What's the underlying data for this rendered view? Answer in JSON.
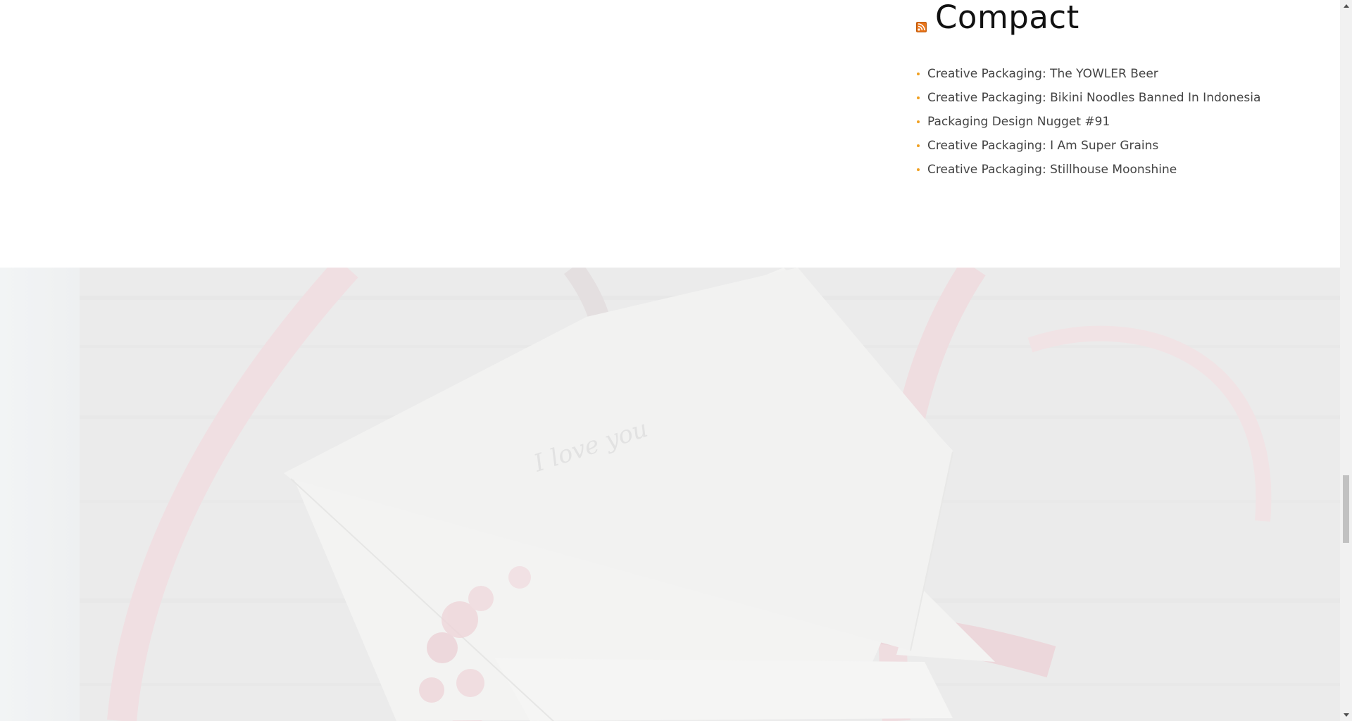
{
  "widget": {
    "title": "Compact",
    "icon": "rss-icon",
    "bullet_color": "#f0a020",
    "posts": [
      {
        "label": "Creative Packaging: The YOWLER Beer"
      },
      {
        "label": "Creative Packaging: Bikini Noodles Banned In Indonesia"
      },
      {
        "label": "Packaging Design Nugget #91"
      },
      {
        "label": "Creative Packaging: I Am Super Grains"
      },
      {
        "label": "Creative Packaging: Stillhouse Moonshine"
      }
    ]
  },
  "hero": {
    "image": "envelope-ribbon-roses-photo",
    "handwriting": "I love you"
  },
  "scrollbar": {
    "up_icon": "scroll-up-arrow-icon",
    "down_icon": "scroll-down-arrow-icon"
  }
}
